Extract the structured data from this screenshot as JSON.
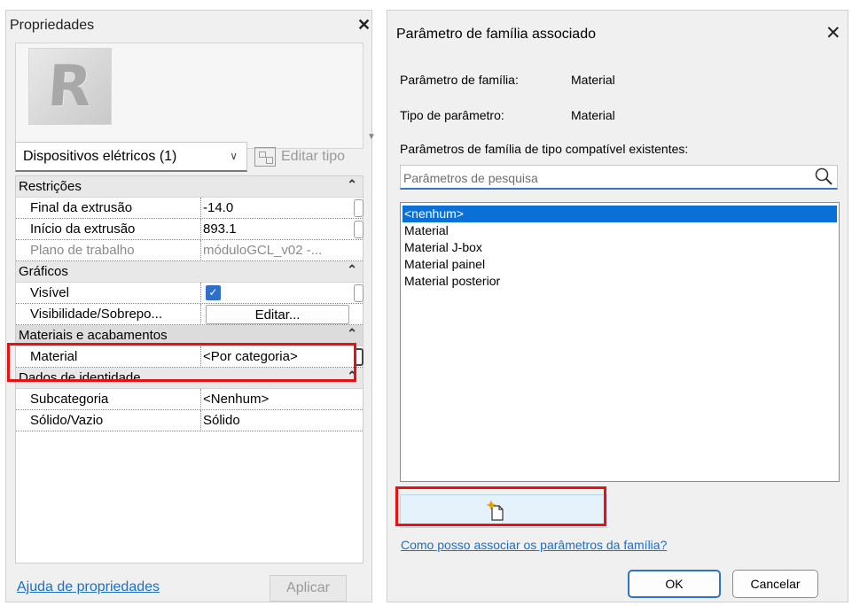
{
  "properties_panel": {
    "title": "Propriedades",
    "logo_letter": "R",
    "type_selector_value": "Dispositivos elétricos (1)",
    "edit_type_label": "Editar tipo",
    "groups": {
      "restricoes": {
        "label": "Restrições",
        "rows": [
          {
            "label": "Final da extrusão",
            "value": "-14.0"
          },
          {
            "label": "Início da extrusão",
            "value": "893.1"
          },
          {
            "label": "Plano de trabalho",
            "value": "móduloGCL_v02 -..."
          }
        ]
      },
      "graficos": {
        "label": "Gráficos",
        "rows": [
          {
            "label": "Visível",
            "checked": true
          },
          {
            "label": "Visibilidade/Sobrepo...",
            "button": "Editar..."
          }
        ]
      },
      "materiais": {
        "label": "Materiais e acabamentos",
        "rows": [
          {
            "label": "Material",
            "value": "<Por categoria>"
          }
        ]
      },
      "identidade": {
        "label": "Dados de identidade",
        "rows": [
          {
            "label": "Subcategoria",
            "value": "<Nenhum>"
          },
          {
            "label": "Sólido/Vazio",
            "value": "Sólido"
          }
        ]
      }
    },
    "help_link": "Ajuda de propriedades",
    "apply_button": "Aplicar"
  },
  "dialog": {
    "title": "Parâmetro de família associado",
    "family_param_label": "Parâmetro de família:",
    "family_param_value": "Material",
    "param_type_label": "Tipo de parâmetro:",
    "param_type_value": "Material",
    "compatible_label": "Parâmetros de família de tipo compatível existentes:",
    "search_placeholder": "Parâmetros de pesquisa",
    "list_items": [
      "<nenhum>",
      "Material",
      "Material J-box",
      "Material painel",
      "Material posterior"
    ],
    "selected_index": 0,
    "help_link": "Como posso associar os parâmetros da família?",
    "ok_button": "OK",
    "cancel_button": "Cancelar"
  },
  "colors": {
    "highlight_red": "#e81010",
    "selection_blue": "#0a6fd6",
    "link_blue": "#1a6fc9"
  }
}
